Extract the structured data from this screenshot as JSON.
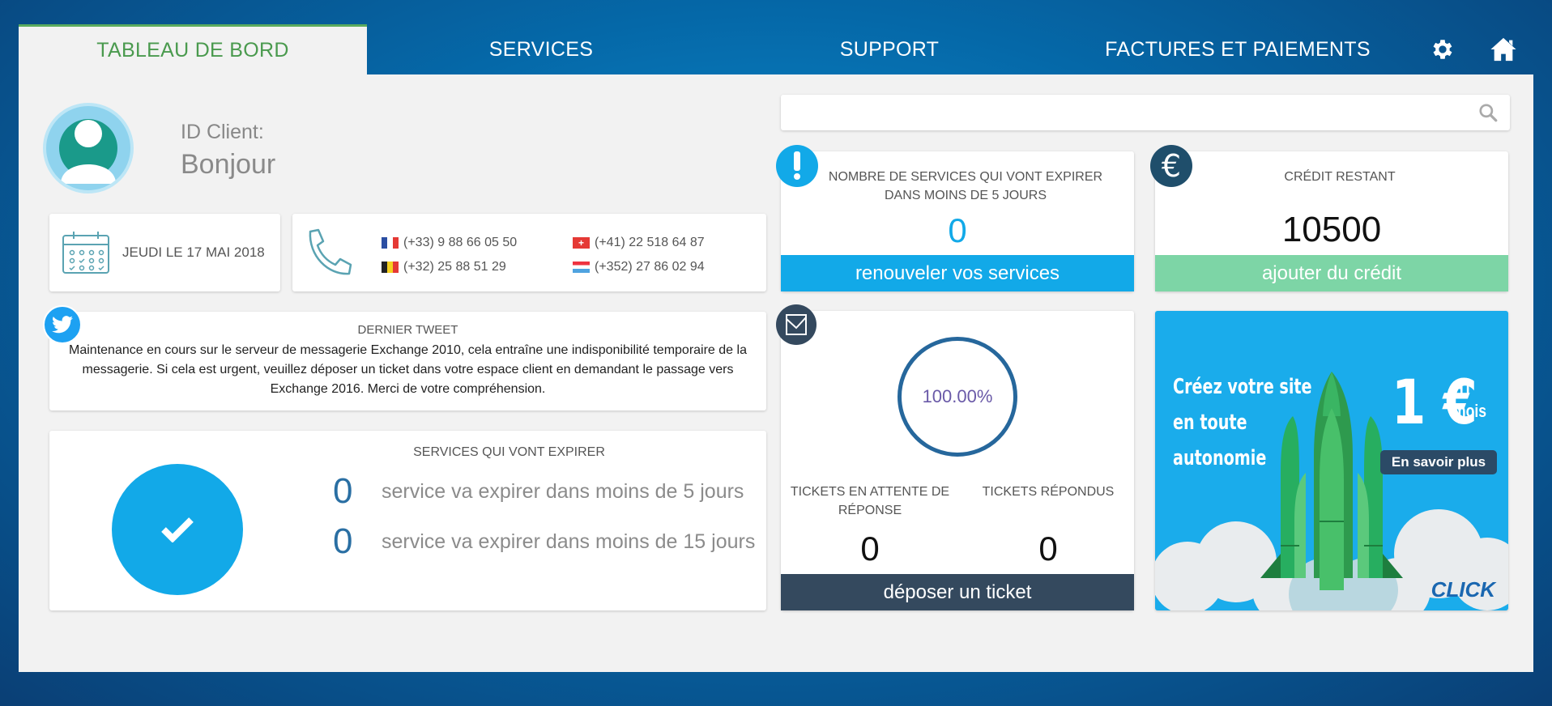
{
  "nav": {
    "tabs": [
      {
        "label": "TABLEAU DE BORD",
        "active": true
      },
      {
        "label": "SERVICES"
      },
      {
        "label": "SUPPORT"
      },
      {
        "label": "FACTURES ET PAIEMENTS"
      }
    ],
    "icons": [
      "gear-icon",
      "home-icon"
    ]
  },
  "profile": {
    "id_label": "ID Client:",
    "greeting": "Bonjour"
  },
  "date": {
    "text": "JEUDI LE 17 MAI 2018"
  },
  "phones": [
    {
      "country": "FR",
      "number": "(+33) 9 88 66 05 50"
    },
    {
      "country": "CH",
      "number": "(+41) 22 518 64 87"
    },
    {
      "country": "BE",
      "number": "(+32) 25 88 51 29"
    },
    {
      "country": "LU",
      "number": "(+352) 27 86 02 94"
    }
  ],
  "search": {
    "placeholder": ""
  },
  "expiring": {
    "title": "NOMBRE DE SERVICES QUI VONT EXPIRER DANS MOINS DE 5 JOURS",
    "count": "0",
    "button": "renouveler vos services"
  },
  "credit": {
    "title": "CRÉDIT RESTANT",
    "amount": "10500",
    "button": "ajouter du crédit"
  },
  "tweet": {
    "title": "DERNIER TWEET",
    "text": "Maintenance en cours sur le serveur de messagerie Exchange 2010, cela entraîne une indisponibilité temporaire de la messagerie. Si cela est urgent, veuillez déposer un ticket dans votre espace client en demandant le passage vers Exchange 2016. Merci de votre compréhension."
  },
  "services": {
    "title": "SERVICES QUI VONT EXPIRER",
    "rows": [
      {
        "count": "0",
        "text": "service va expirer dans moins de 5 jours"
      },
      {
        "count": "0",
        "text": "service va expirer dans moins de 15 jours"
      }
    ]
  },
  "tickets": {
    "percent": "100.00%",
    "pending_label": "TICKETS EN ATTENTE DE RÉPONSE",
    "pending_count": "0",
    "answered_label": "TICKETS RÉPONDUS",
    "answered_count": "0",
    "button": "déposer un ticket"
  },
  "promo": {
    "line1": "Créez votre site",
    "line2": "en toute",
    "line3": "autonomie",
    "price": "1 €",
    "unit1": "HT",
    "unit2": "mois",
    "button": "En savoir plus",
    "logo": "CLICK"
  },
  "colors": {
    "accent_green": "#4a9a4e",
    "blue_button": "#12a9e8",
    "green_button": "#7dd5a6",
    "dark_button": "#34495e"
  }
}
